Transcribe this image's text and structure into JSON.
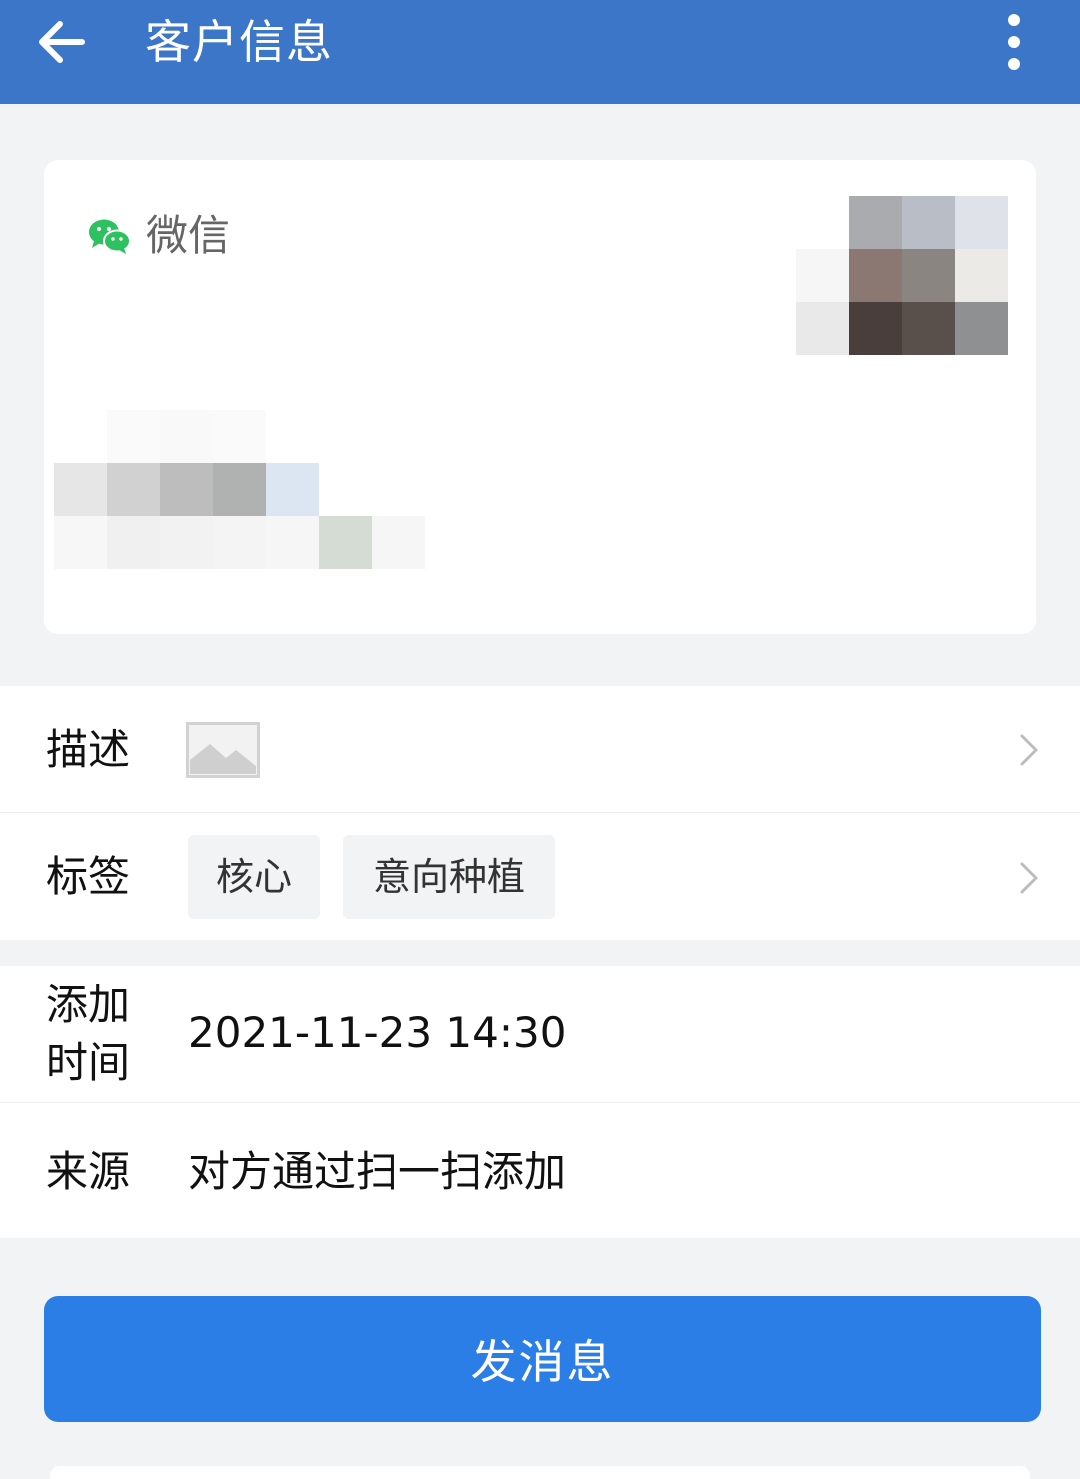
{
  "header": {
    "title": "客户信息",
    "back_icon": "arrow-left-icon",
    "more_icon": "more-vertical-icon",
    "color": "#3c76c8"
  },
  "card": {
    "source_platform": "微信",
    "platform_icon": "wechat-icon",
    "platform_color": "#2dc160"
  },
  "details": {
    "description": {
      "label": "描述",
      "icon": "image-placeholder-icon"
    },
    "tags": {
      "label": "标签",
      "items": [
        "核心",
        "意向种植"
      ]
    },
    "added_time": {
      "label": "添加\n时间",
      "label_line1": "添加",
      "label_line2": "时间",
      "value": "2021-11-23 14:30"
    },
    "source": {
      "label": "来源",
      "value": "对方通过扫一扫添加"
    }
  },
  "actions": {
    "send_message": "发消息",
    "accent": "#2a7ee6"
  }
}
